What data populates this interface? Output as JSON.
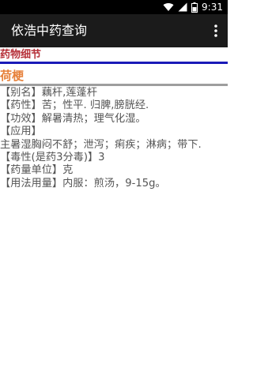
{
  "status_bar": {
    "time": "9:31"
  },
  "app_bar": {
    "title": "依浩中药查询"
  },
  "section": {
    "header": "药物细节"
  },
  "herb": {
    "name": "荷梗"
  },
  "details": [
    "【别名】藕杆,莲蓬杆",
    "【药性】苦；性平. 归脾,膀胱经.",
    "【功效】解暑清热；理气化湿。",
    "【应用】",
    "主暑湿胸闷不舒；泄泻；痢疾；淋病；带下.",
    "【毒性(是药3分毒)】3",
    "【药量单位】克",
    "【用法用量】内服：煎汤，9-15g。"
  ],
  "colors": {
    "section_header": "#b6313a",
    "herb_name": "#e7823c",
    "divider_blue": "#1a1ab8",
    "divider_gray": "#9e9e9e",
    "app_bar": "#1b1b1b"
  },
  "icons": [
    "wifi-icon",
    "signal-icon",
    "battery-icon",
    "overflow-menu-icon"
  ]
}
